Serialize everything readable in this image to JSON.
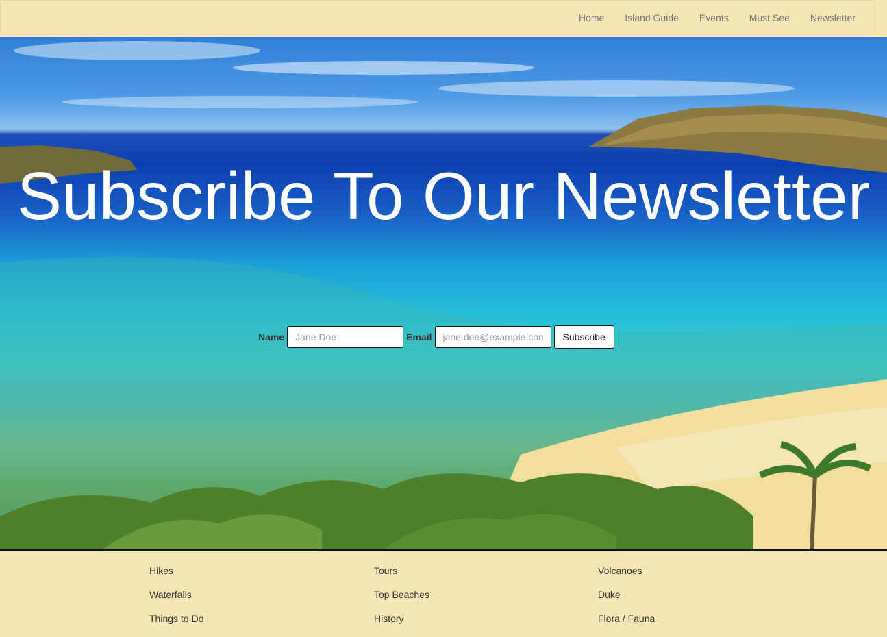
{
  "nav": {
    "items": [
      "Home",
      "Island Guide",
      "Events",
      "Must See",
      "Newsletter"
    ]
  },
  "hero": {
    "title": "Subscribe To Our Newsletter"
  },
  "form": {
    "name_label": "Name",
    "name_placeholder": "Jane Doe",
    "email_label": "Email",
    "email_placeholder": "jane.doe@example.com",
    "submit_label": "Subscribe"
  },
  "footer": {
    "columns": [
      [
        "Hikes",
        "Waterfalls",
        "Things to Do"
      ],
      [
        "Tours",
        "Top Beaches",
        "History"
      ],
      [
        "Volcanoes",
        "Duke",
        "Flora / Fauna"
      ]
    ]
  },
  "colors": {
    "nav_bg": "#f6e5b4",
    "footer_bg": "#f6e5b4"
  }
}
